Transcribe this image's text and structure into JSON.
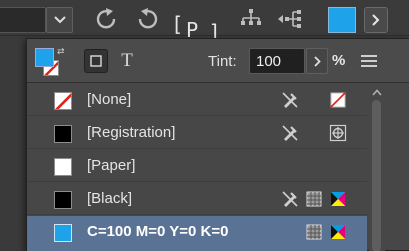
{
  "toolbar": {
    "field_value": "",
    "bracket_left": "[",
    "bracket_char": "P",
    "bracket_right": "]",
    "accent": "#1ea3ea",
    "icons": [
      "chevron-down-icon",
      "redo-icon",
      "undo-icon",
      "align-hierarchy-icon",
      "distribute-hierarchy-icon",
      "chevron-right-icon"
    ]
  },
  "swatches_panel": {
    "fill_color": "#1ea3ea",
    "stroke_color": "#ffffff",
    "container_button": "format-container-icon",
    "text_button_label": "T",
    "tint_label": "Tint:",
    "tint_value": "100",
    "tint_unit": "%",
    "menu_icon": "hamburger-menu-icon",
    "swatches": [
      {
        "label": "[None]",
        "chip": "none",
        "icons": [
          "pencil-crossed-icon",
          "none-swatch-icon"
        ]
      },
      {
        "label": "[Registration]",
        "chip": "#000000",
        "icons": [
          "pencil-crossed-icon",
          "registration-target-icon"
        ]
      },
      {
        "label": "[Paper]",
        "chip": "#ffffff",
        "icons": []
      },
      {
        "label": "[Black]",
        "chip": "#000000",
        "icons": [
          "pencil-crossed-icon",
          "process-color-icon",
          "cmyk-icon"
        ]
      },
      {
        "label": "C=100 M=0 Y=0 K=0",
        "chip": "#1ea3ea",
        "selected": true,
        "icons": [
          "process-color-icon",
          "cmyk-icon"
        ]
      }
    ]
  }
}
